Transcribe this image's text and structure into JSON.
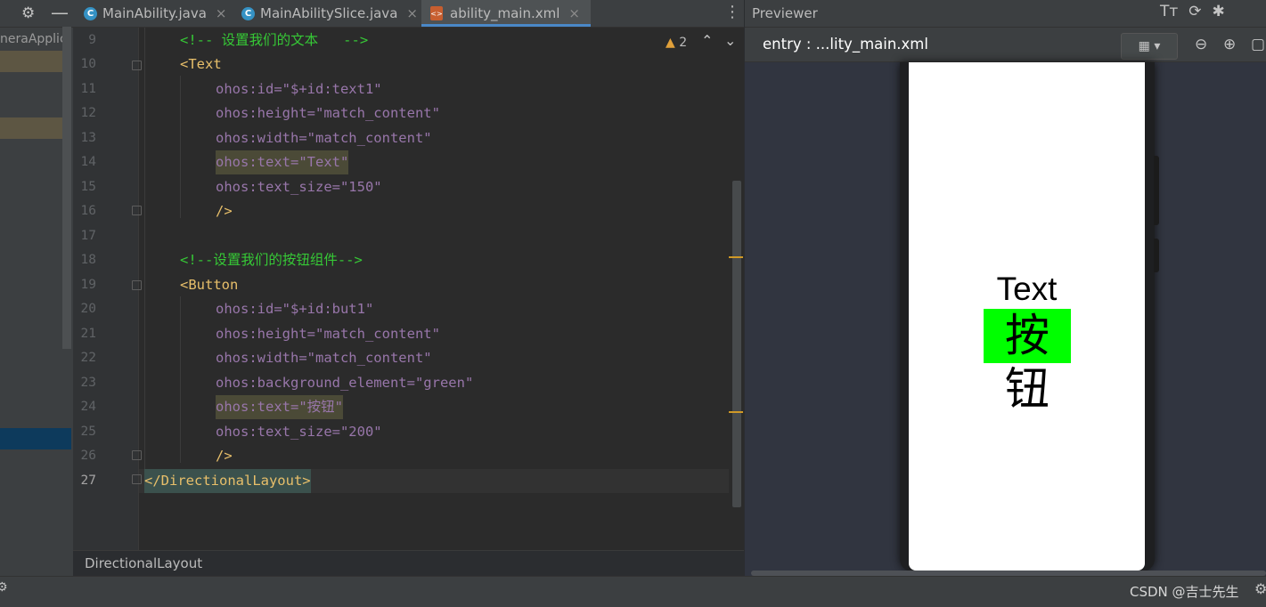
{
  "left_panel": {
    "project_label": "neraApplic"
  },
  "tabs": [
    {
      "label": "MainAbility.java",
      "icon": "java-class-icon",
      "active": false
    },
    {
      "label": "MainAbilitySlice.java",
      "icon": "java-class-icon",
      "active": false
    },
    {
      "label": "ability_main.xml",
      "icon": "xml-file-icon",
      "active": true
    }
  ],
  "editor": {
    "warning_count": "2",
    "current_line": 27,
    "lines": [
      {
        "n": "9",
        "text": "<!-- 设置我们的文本   -->"
      },
      {
        "n": "10",
        "text": "<Text"
      },
      {
        "n": "11",
        "text": "ohos:id=\"$+id:text1\""
      },
      {
        "n": "12",
        "text": "ohos:height=\"match_content\""
      },
      {
        "n": "13",
        "text": "ohos:width=\"match_content\""
      },
      {
        "n": "14",
        "text": "ohos:text=\"Text\""
      },
      {
        "n": "15",
        "text": "ohos:text_size=\"150\""
      },
      {
        "n": "16",
        "text": "/>"
      },
      {
        "n": "17",
        "text": ""
      },
      {
        "n": "18",
        "text": "<!--设置我们的按钮组件-->"
      },
      {
        "n": "19",
        "text": "<Button"
      },
      {
        "n": "20",
        "text": "ohos:id=\"$+id:but1\""
      },
      {
        "n": "21",
        "text": "ohos:height=\"match_content\""
      },
      {
        "n": "22",
        "text": "ohos:width=\"match_content\""
      },
      {
        "n": "23",
        "text": "ohos:background_element=\"green\""
      },
      {
        "n": "24",
        "text": "ohos:text=\"按钮\""
      },
      {
        "n": "25",
        "text": "ohos:text_size=\"200\""
      },
      {
        "n": "26",
        "text": "/>"
      },
      {
        "n": "27",
        "text": "</DirectionalLayout>"
      }
    ]
  },
  "breadcrumb": "DirectionalLayout",
  "previewer": {
    "title": "Previewer",
    "entry_label": "entry : ...lity_main.xml",
    "phone": {
      "text": "Text",
      "button_label": "按钮",
      "button_color": "#00ff00"
    }
  },
  "status": {
    "watermark": "CSDN @吉士先生"
  }
}
